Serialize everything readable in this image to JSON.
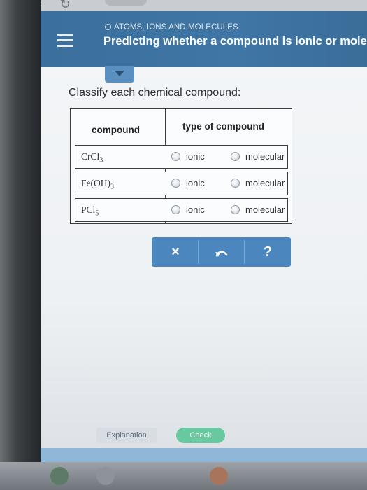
{
  "header": {
    "topic": "ATOMS, IONS AND MOLECULES",
    "title": "Predicting whether a compound is ionic or molecu"
  },
  "prompt": "Classify each chemical compound:",
  "table": {
    "col_compound": "compound",
    "col_type": "type of compound",
    "rows": [
      {
        "formula_base": "CrCl",
        "formula_sub": "3",
        "formula_tail": "",
        "option_ionic": "ionic",
        "option_molecular": "molecular"
      },
      {
        "formula_base": "Fe(OH)",
        "formula_sub": "3",
        "formula_tail": "",
        "option_ionic": "ionic",
        "option_molecular": "molecular"
      },
      {
        "formula_base": "PCl",
        "formula_sub": "5",
        "formula_tail": "",
        "option_ionic": "ionic",
        "option_molecular": "molecular"
      }
    ]
  },
  "actions": {
    "clear": "×",
    "help": "?"
  },
  "bottom": {
    "explanation": "Explanation",
    "check": "Check"
  },
  "colors": {
    "header": "#3f76a5",
    "action_bar": "#4c86bf",
    "check": "#68c8a0"
  },
  "icons": [
    "hamburger-menu-icon",
    "chevron-down-icon",
    "radio-icon",
    "undo-icon"
  ]
}
